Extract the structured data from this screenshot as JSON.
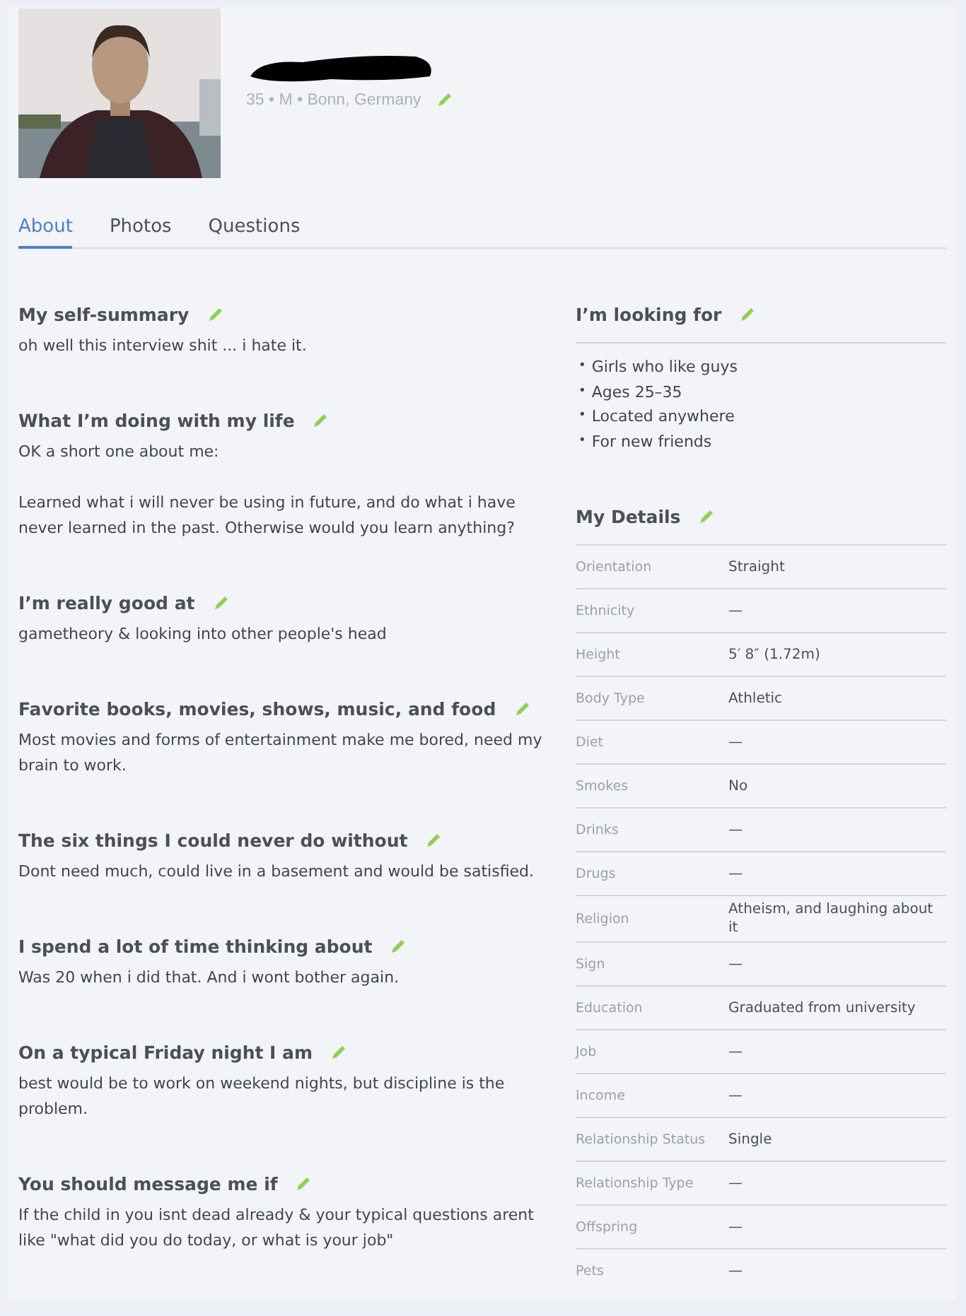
{
  "profile": {
    "name_redacted": true,
    "basics": "35 • M • Bonn, Germany"
  },
  "tabs": [
    {
      "label": "About",
      "selected": true
    },
    {
      "label": "Photos",
      "selected": false
    },
    {
      "label": "Questions",
      "selected": false
    }
  ],
  "essays": [
    {
      "title": "My self-summary",
      "text": "oh well this interview shit ... i hate it."
    },
    {
      "title": "What I’m doing with my life",
      "text": "OK a short one about me:\n\nLearned what i will never be using in future, and do what i have never learned in the past. Otherwise would you learn anything?"
    },
    {
      "title": "I’m really good at",
      "text": "gametheory & looking into other people's head"
    },
    {
      "title": "Favorite books, movies, shows, music, and food",
      "text": "Most movies and forms of entertainment make me bored, need my brain to work."
    },
    {
      "title": "The six things I could never do without",
      "text": "Dont need much, could live in a basement and would be satisfied."
    },
    {
      "title": "I spend a lot of time thinking about",
      "text": "Was 20 when i did that. And i wont bother again."
    },
    {
      "title": "On a typical Friday night I am",
      "text": "best would be to work on weekend nights, but discipline is the problem."
    },
    {
      "title": "You should message me if",
      "text": "If the child in you isnt dead already & your typical questions arent like \"what did you do today, or what is your job\""
    }
  ],
  "looking_for": {
    "title": "I’m looking for",
    "items": [
      {
        "bullet": "•",
        "text": "Girls who like guys"
      },
      {
        "bullet": "•",
        "text": "Ages 25–35"
      },
      {
        "bullet": "•",
        "text": "Located anywhere"
      },
      {
        "bullet": "•",
        "text": "For new friends"
      }
    ]
  },
  "details": {
    "title": "My Details",
    "rows": [
      {
        "label": "Orientation",
        "value": "Straight"
      },
      {
        "label": "Ethnicity",
        "value": "—"
      },
      {
        "label": "Height",
        "value": "5′ 8″ (1.72m)"
      },
      {
        "label": "Body Type",
        "value": "Athletic"
      },
      {
        "label": "Diet",
        "value": "—"
      },
      {
        "label": "Smokes",
        "value": "No"
      },
      {
        "label": "Drinks",
        "value": "—"
      },
      {
        "label": "Drugs",
        "value": "—"
      },
      {
        "label": "Religion",
        "value": "Atheism, and laughing about it"
      },
      {
        "label": "Sign",
        "value": "—"
      },
      {
        "label": "Education",
        "value": "Graduated from university"
      },
      {
        "label": "Job",
        "value": "—"
      },
      {
        "label": "Income",
        "value": "—"
      },
      {
        "label": "Relationship Status",
        "value": "Single"
      },
      {
        "label": "Relationship Type",
        "value": "—"
      },
      {
        "label": "Offspring",
        "value": "—"
      },
      {
        "label": "Pets",
        "value": "—"
      }
    ]
  }
}
